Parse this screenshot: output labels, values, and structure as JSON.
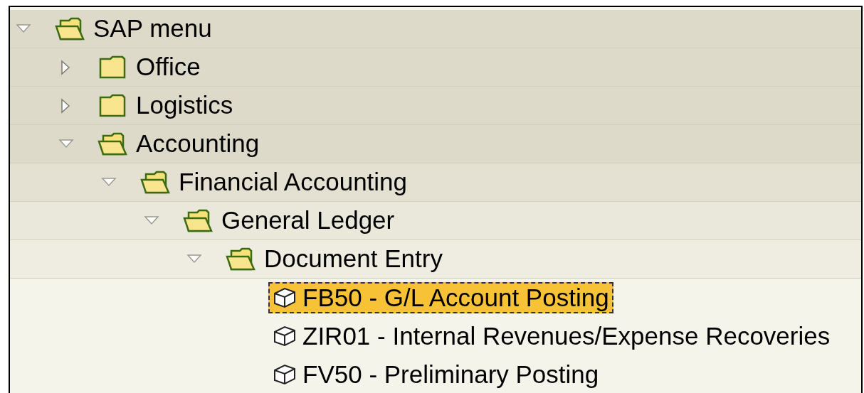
{
  "tree": [
    {
      "kind": "folder",
      "label": "SAP menu",
      "expanded": true,
      "children": [
        {
          "kind": "folder",
          "label": "Office",
          "expanded": false
        },
        {
          "kind": "folder",
          "label": "Logistics",
          "expanded": false
        },
        {
          "kind": "folder",
          "label": "Accounting",
          "expanded": true,
          "children": [
            {
              "kind": "folder",
              "label": "Financial Accounting",
              "expanded": true,
              "children": [
                {
                  "kind": "folder",
                  "label": "General Ledger",
                  "expanded": true,
                  "children": [
                    {
                      "kind": "folder",
                      "label": "Document Entry",
                      "expanded": true,
                      "children": [
                        {
                          "kind": "transaction",
                          "label": "FB50 - G/L Account Posting",
                          "selected": true
                        },
                        {
                          "kind": "transaction",
                          "label": "ZIR01 - Internal Revenues/Expense Recoveries",
                          "selected": false
                        },
                        {
                          "kind": "transaction",
                          "label": "FV50 - Preliminary Posting",
                          "selected": false
                        }
                      ]
                    }
                  ]
                }
              ]
            }
          ]
        }
      ]
    }
  ]
}
